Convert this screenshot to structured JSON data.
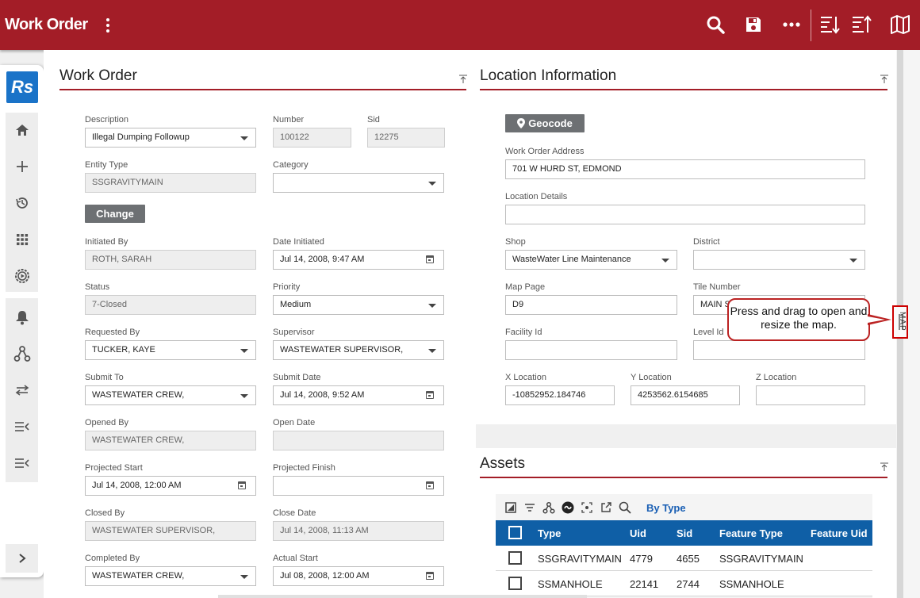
{
  "header": {
    "title": "Work Order",
    "icons": [
      "kebab-menu-icon",
      "search-icon",
      "save-icon",
      "more-icon",
      "sort-descending-icon",
      "sort-ascending-icon",
      "map-icon"
    ],
    "color": "#a31d27"
  },
  "rail": {
    "logo": "Rs",
    "items": [
      "home-icon",
      "add-icon",
      "history-icon",
      "apps-icon",
      "settings-icon",
      "notifications-icon",
      "workflow-icon",
      "swap-icon",
      "list-collapse-icon",
      "list-collapse-icon",
      "expand-icon"
    ]
  },
  "work_order": {
    "section_title": "Work Order",
    "description": {
      "label": "Description",
      "value": "Illegal Dumping Followup"
    },
    "number": {
      "label": "Number",
      "value": "100122"
    },
    "sid": {
      "label": "Sid",
      "value": "12275"
    },
    "entity_type": {
      "label": "Entity Type",
      "value": "SSGRAVITYMAIN"
    },
    "category": {
      "label": "Category",
      "value": ""
    },
    "change_button": "Change",
    "initiated_by": {
      "label": "Initiated By",
      "value": "ROTH, SARAH"
    },
    "date_initiated": {
      "label": "Date Initiated",
      "value": "Jul 14, 2008, 9:47 AM"
    },
    "status": {
      "label": "Status",
      "value": "7-Closed"
    },
    "priority": {
      "label": "Priority",
      "value": "Medium"
    },
    "requested_by": {
      "label": "Requested By",
      "value": "TUCKER, KAYE"
    },
    "supervisor": {
      "label": "Supervisor",
      "value": "WASTEWATER SUPERVISOR,"
    },
    "submit_to": {
      "label": "Submit To",
      "value": "WASTEWATER CREW,"
    },
    "submit_date": {
      "label": "Submit Date",
      "value": "Jul 14, 2008, 9:52 AM"
    },
    "opened_by": {
      "label": "Opened By",
      "value": "WASTEWATER CREW,"
    },
    "open_date": {
      "label": "Open Date",
      "value": ""
    },
    "projected_start": {
      "label": "Projected Start",
      "value": "Jul 14, 2008, 12:00 AM"
    },
    "projected_finish": {
      "label": "Projected Finish",
      "value": ""
    },
    "closed_by": {
      "label": "Closed By",
      "value": "WASTEWATER SUPERVISOR,"
    },
    "close_date": {
      "label": "Close Date",
      "value": "Jul 14, 2008, 11:13 AM"
    },
    "completed_by": {
      "label": "Completed By",
      "value": "WASTEWATER CREW,"
    },
    "actual_start": {
      "label": "Actual Start",
      "value": "Jul 08, 2008, 12:00 AM"
    }
  },
  "location": {
    "section_title": "Location Information",
    "geocode_button": "Geocode",
    "address": {
      "label": "Work Order Address",
      "value": "701 W HURD ST,  EDMOND"
    },
    "details": {
      "label": "Location Details",
      "value": ""
    },
    "shop": {
      "label": "Shop",
      "value": "WasteWater Line Maintenance"
    },
    "district": {
      "label": "District",
      "value": ""
    },
    "map_page": {
      "label": "Map Page",
      "value": "D9"
    },
    "tile_number": {
      "label": "Tile Number",
      "value": "MAIN S"
    },
    "facility_id": {
      "label": "Facility Id",
      "value": ""
    },
    "level_id": {
      "label": "Level Id",
      "value": ""
    },
    "x_location": {
      "label": "X Location",
      "value": "-10852952.184746"
    },
    "y_location": {
      "label": "Y Location",
      "value": "4253562.6154685"
    },
    "z_location": {
      "label": "Z Location",
      "value": ""
    }
  },
  "assets": {
    "section_title": "Assets",
    "by_type": "By Type",
    "columns": [
      "Type",
      "Uid",
      "Sid",
      "Feature Type",
      "Feature Uid"
    ],
    "rows": [
      {
        "type": "SSGRAVITYMAIN",
        "uid": "4779",
        "sid": "4655",
        "feature_type": "SSGRAVITYMAIN",
        "feature_uid": ""
      },
      {
        "type": "SSMANHOLE",
        "uid": "22141",
        "sid": "2744",
        "feature_type": "SSMANHOLE",
        "feature_uid": ""
      }
    ]
  },
  "map_panel": {
    "label": "MAP",
    "tooltip": "Press and drag to open and resize the map."
  }
}
